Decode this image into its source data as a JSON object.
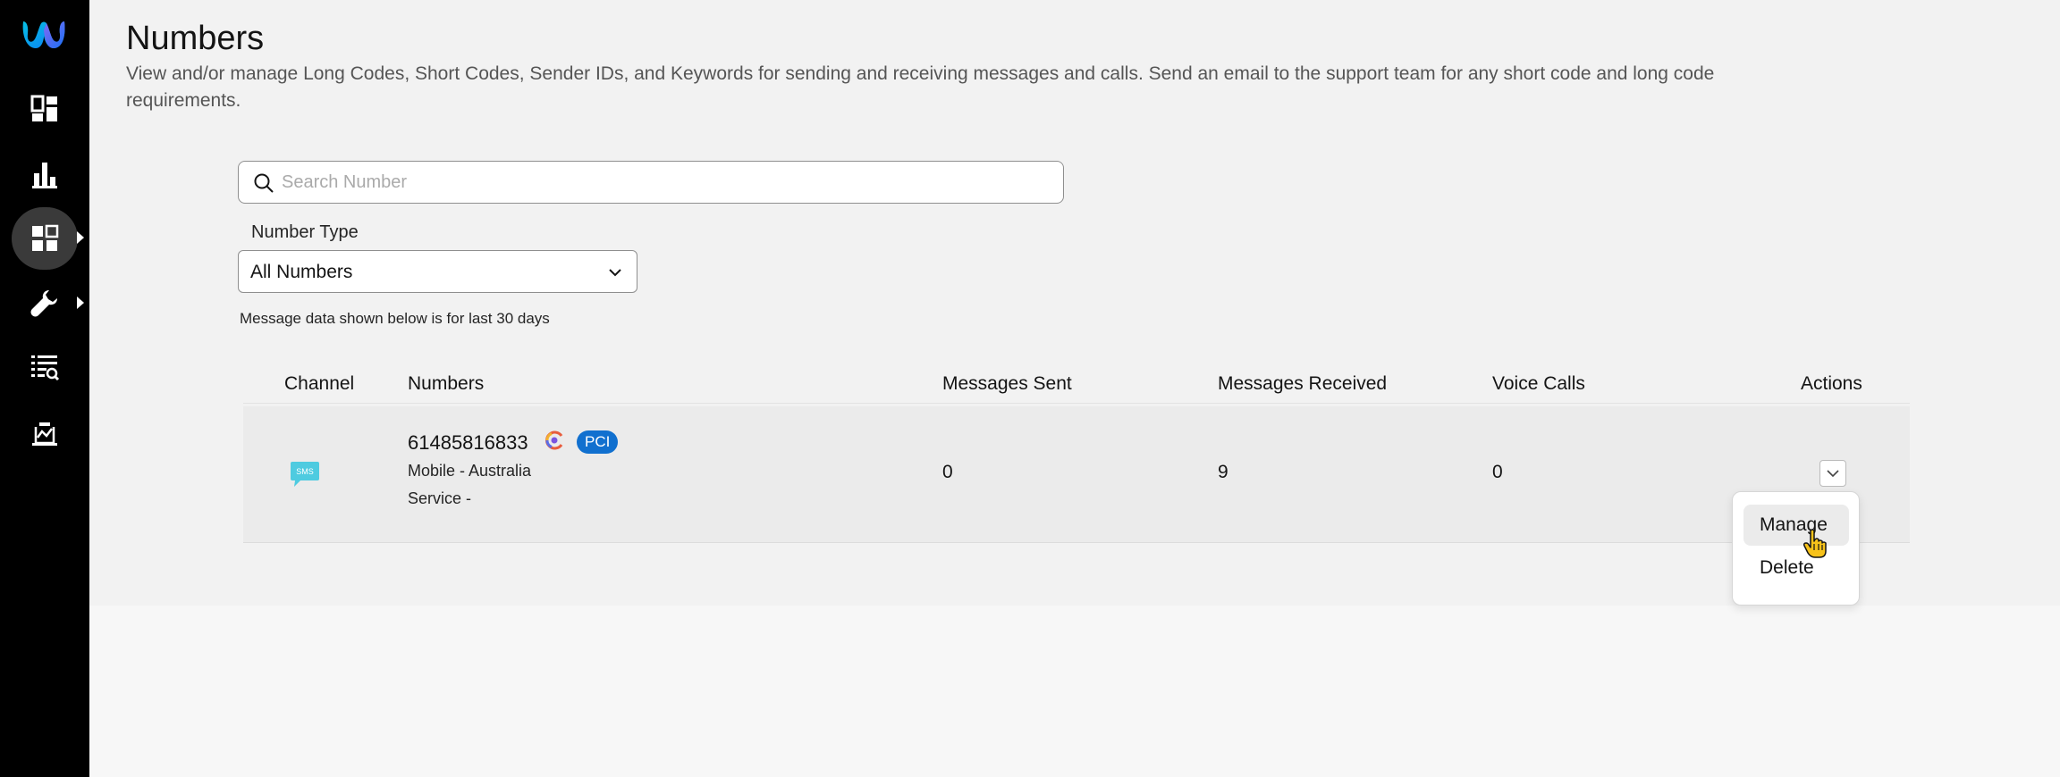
{
  "sidebar": {
    "items": [
      {
        "name": "dashboard-icon"
      },
      {
        "name": "analytics-icon"
      },
      {
        "name": "apps-icon",
        "active": true
      },
      {
        "name": "wrench-icon"
      },
      {
        "name": "reports-search-icon"
      },
      {
        "name": "monitoring-icon"
      }
    ]
  },
  "header": {
    "title": "Numbers",
    "description": "View and/or manage Long Codes, Short Codes, Sender IDs, and Keywords for sending and receiving messages and calls. Send an email to the support team for any short code and long code requirements."
  },
  "search": {
    "placeholder": "Search Number",
    "value": ""
  },
  "filter": {
    "label": "Number Type",
    "selected": "All Numbers"
  },
  "note": "Message data shown below is for last 30 days",
  "table": {
    "columns": [
      "Channel",
      "Numbers",
      "Messages Sent",
      "Messages Received",
      "Voice Calls",
      "Actions"
    ],
    "rows": [
      {
        "channel_icon": "sms-icon",
        "channel_icon_text": "SMS",
        "number": "61485816833",
        "badge": "PCI",
        "type_line": "Mobile - Australia",
        "service_line": "Service -",
        "messages_sent": "0",
        "messages_received": "9",
        "voice_calls": "0"
      }
    ]
  },
  "actions_menu": {
    "items": [
      "Manage",
      "Delete"
    ]
  },
  "colors": {
    "sidebar_bg": "#000000",
    "badge_bg": "#1170cf",
    "sms_icon": "#4ecbe0",
    "row_bg": "#ebebeb"
  }
}
